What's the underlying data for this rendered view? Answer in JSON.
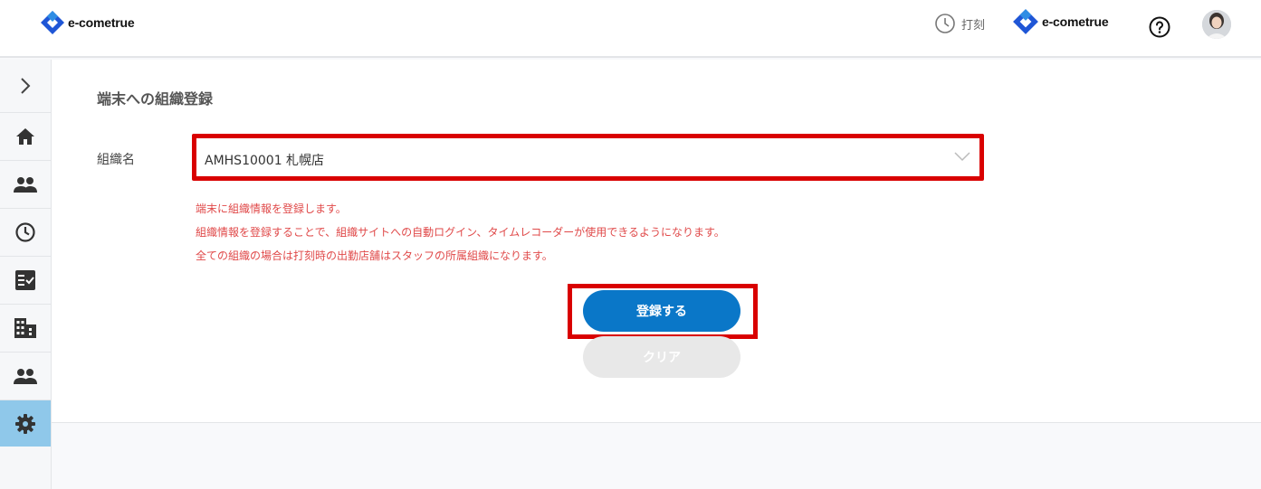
{
  "header": {
    "brand_name": "e-cometrue",
    "punch_label": "打刻",
    "center_brand_name": "e-cometrue"
  },
  "sidebar": {
    "items": [
      {
        "name": "home",
        "icon": "home-icon"
      },
      {
        "name": "staff",
        "icon": "people-icon"
      },
      {
        "name": "attendance",
        "icon": "clock-icon"
      },
      {
        "name": "tasks",
        "icon": "checklist-icon"
      },
      {
        "name": "organization",
        "icon": "building-icon"
      },
      {
        "name": "users",
        "icon": "people-icon"
      },
      {
        "name": "settings",
        "icon": "gear-icon",
        "active": true
      }
    ]
  },
  "main": {
    "title": "端末への組織登録",
    "org_label": "組織名",
    "org_value": "AMHS10001 札幌店",
    "notes": [
      "端末に組織情報を登録します。",
      "組織情報を登録することで、組織サイトへの自動ログイン、タイムレコーダーが使用できるようになります。",
      "全ての組織の場合は打刻時の出勤店舗はスタッフの所属組織になります。"
    ],
    "register_button": "登録する",
    "clear_button": "クリア"
  },
  "colors": {
    "primary": "#0a77c8",
    "highlight": "#d90000",
    "note_text": "#e04a4a",
    "sidebar_active": "#8fc8ea"
  }
}
